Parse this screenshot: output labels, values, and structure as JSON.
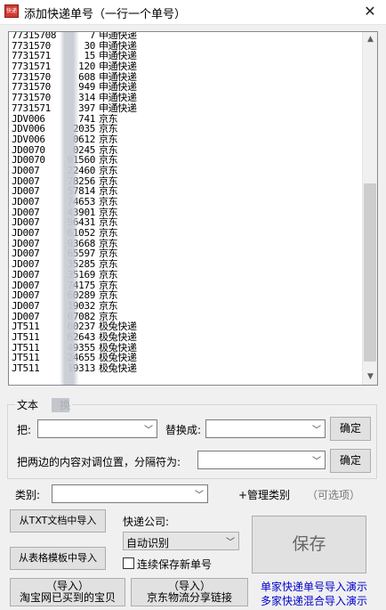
{
  "window": {
    "title": "添加快递单号（一行一个单号）",
    "icon_text": "快递",
    "close_glyph": "✕"
  },
  "list": {
    "rows": [
      {
        "prefix": "77315708",
        "suffix": "7",
        "carrier": "申通快递"
      },
      {
        "prefix": "7731570",
        "suffix": "30",
        "carrier": "申通快递"
      },
      {
        "prefix": "7731571",
        "suffix": "15",
        "carrier": "申通快递"
      },
      {
        "prefix": "7731571",
        "suffix": "120",
        "carrier": "申通快递"
      },
      {
        "prefix": "7731570",
        "suffix": "608",
        "carrier": "申通快递"
      },
      {
        "prefix": "7731570",
        "suffix": "949",
        "carrier": "申通快递"
      },
      {
        "prefix": "7731570",
        "suffix": "314",
        "carrier": "申通快递"
      },
      {
        "prefix": "7731571",
        "suffix": "397",
        "carrier": "申通快递"
      },
      {
        "prefix": "JDV006",
        "suffix": "741",
        "carrier": "京东"
      },
      {
        "prefix": "JDV006",
        "suffix": "2035",
        "carrier": "京东"
      },
      {
        "prefix": "JDV006",
        "suffix": "0612",
        "carrier": "京东"
      },
      {
        "prefix": "JD0070",
        "suffix": "0245",
        "carrier": "京东"
      },
      {
        "prefix": "JD0070",
        "suffix": "01560",
        "carrier": "京东"
      },
      {
        "prefix": "JD007",
        "suffix": "22460",
        "carrier": "京东"
      },
      {
        "prefix": "JD007",
        "suffix": "78256",
        "carrier": "京东"
      },
      {
        "prefix": "JD007",
        "suffix": "57814",
        "carrier": "京东"
      },
      {
        "prefix": "JD007",
        "suffix": "74653",
        "carrier": "京东"
      },
      {
        "prefix": "JD007",
        "suffix": "43901",
        "carrier": "京东"
      },
      {
        "prefix": "JD007",
        "suffix": "96431",
        "carrier": "京东"
      },
      {
        "prefix": "JD007",
        "suffix": "61052",
        "carrier": "京东"
      },
      {
        "prefix": "JD007",
        "suffix": "93668",
        "carrier": "京东"
      },
      {
        "prefix": "JD007",
        "suffix": "65597",
        "carrier": "京东"
      },
      {
        "prefix": "JD007",
        "suffix": "35285",
        "carrier": "京东"
      },
      {
        "prefix": "JD007",
        "suffix": "35169",
        "carrier": "京东"
      },
      {
        "prefix": "JD007",
        "suffix": "74175",
        "carrier": "京东"
      },
      {
        "prefix": "JD007",
        "suffix": "60289",
        "carrier": "京东"
      },
      {
        "prefix": "JD007",
        "suffix": "19032",
        "carrier": "京东"
      },
      {
        "prefix": "JD007",
        "suffix": "67082",
        "carrier": "京东"
      },
      {
        "prefix": "JT511",
        "suffix": "60237",
        "carrier": "极兔快递"
      },
      {
        "prefix": "JT511",
        "suffix": "62643",
        "carrier": "极兔快递"
      },
      {
        "prefix": "JT511",
        "suffix": "49355",
        "carrier": "极兔快递"
      },
      {
        "prefix": "JT511",
        "suffix": "24655",
        "carrier": "极兔快递"
      },
      {
        "prefix": "JT511",
        "suffix": "19313",
        "carrier": "极兔快递"
      }
    ],
    "scroll_up": "▲",
    "scroll_down": "▼"
  },
  "replace_group": {
    "legend": "文本",
    "legend_suffix": "换",
    "from_label": "把:",
    "to_label": "替换成:",
    "confirm_label": "确定",
    "swap_label": "把两边的内容对调位置，分隔符为:",
    "swap_confirm_label": "确定"
  },
  "category": {
    "label": "类别:",
    "manage_label": "+管理类别",
    "optional_label": "（可选项）"
  },
  "import": {
    "txt_button": "从TXT文档中导入",
    "template_button": "从表格模板中导入",
    "taobao_line1": "（导入）",
    "taobao_line2": "淘宝网已买到的宝贝",
    "jd_line1": "（导入）",
    "jd_line2": "京东物流分享链接"
  },
  "courier": {
    "label": "快递公司:",
    "selected": "自动识别",
    "continuous_save_label": "连续保存新单号"
  },
  "actions": {
    "save_label": "保存",
    "single_demo_link": "单家快递单号导入演示",
    "multi_demo_link": "多家快递混合导入演示"
  },
  "colors": {
    "link": "#0000cc",
    "icon_red": "#d23a2f"
  }
}
